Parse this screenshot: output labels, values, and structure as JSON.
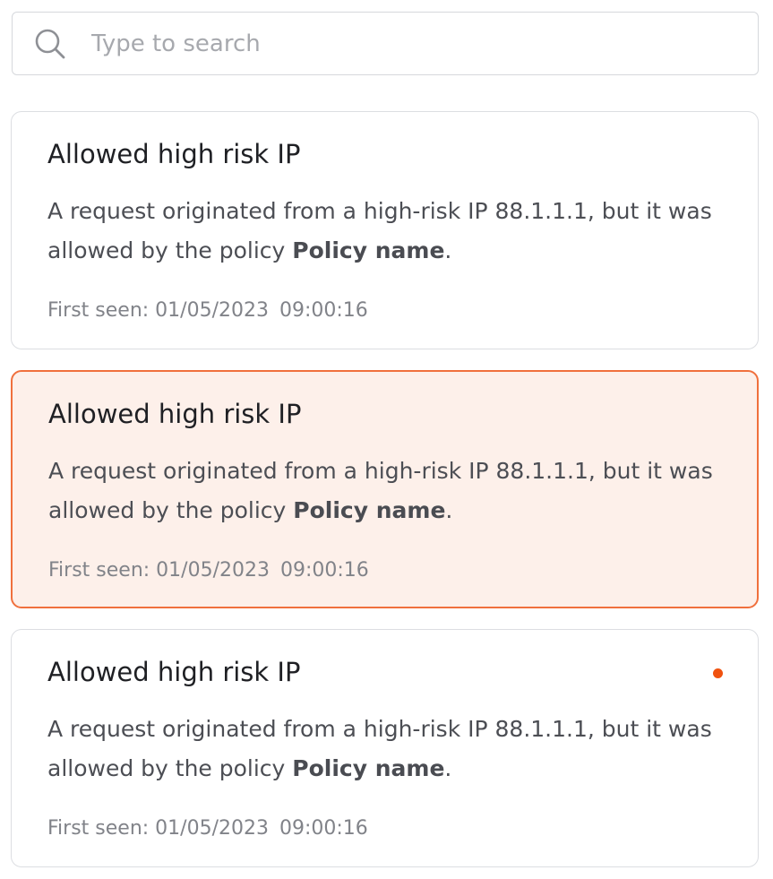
{
  "search": {
    "placeholder": "Type to search",
    "value": "",
    "icon": "search-icon"
  },
  "colors": {
    "accent": "#f0703d",
    "selected_bg": "#fdf0ea",
    "unread_dot": "#f0520f"
  },
  "alerts": [
    {
      "title": "Allowed high risk IP",
      "desc_prefix": "A request originated from a high-risk IP 88.1.1.1, but it was allowed by the policy ",
      "policy": "Policy name",
      "desc_suffix": ".",
      "first_seen_label": "First seen: 01/05/2023",
      "first_seen_time": "09:00:16",
      "selected": false,
      "unread": false
    },
    {
      "title": "Allowed high risk IP",
      "desc_prefix": "A request originated from a high-risk IP 88.1.1.1, but it was allowed by the policy ",
      "policy": "Policy name",
      "desc_suffix": ".",
      "first_seen_label": "First seen: 01/05/2023",
      "first_seen_time": "09:00:16",
      "selected": true,
      "unread": false
    },
    {
      "title": "Allowed high risk IP",
      "desc_prefix": "A request originated from a high-risk IP 88.1.1.1, but it was allowed by the policy ",
      "policy": "Policy name",
      "desc_suffix": ".",
      "first_seen_label": "First seen: 01/05/2023",
      "first_seen_time": "09:00:16",
      "selected": false,
      "unread": true
    }
  ]
}
